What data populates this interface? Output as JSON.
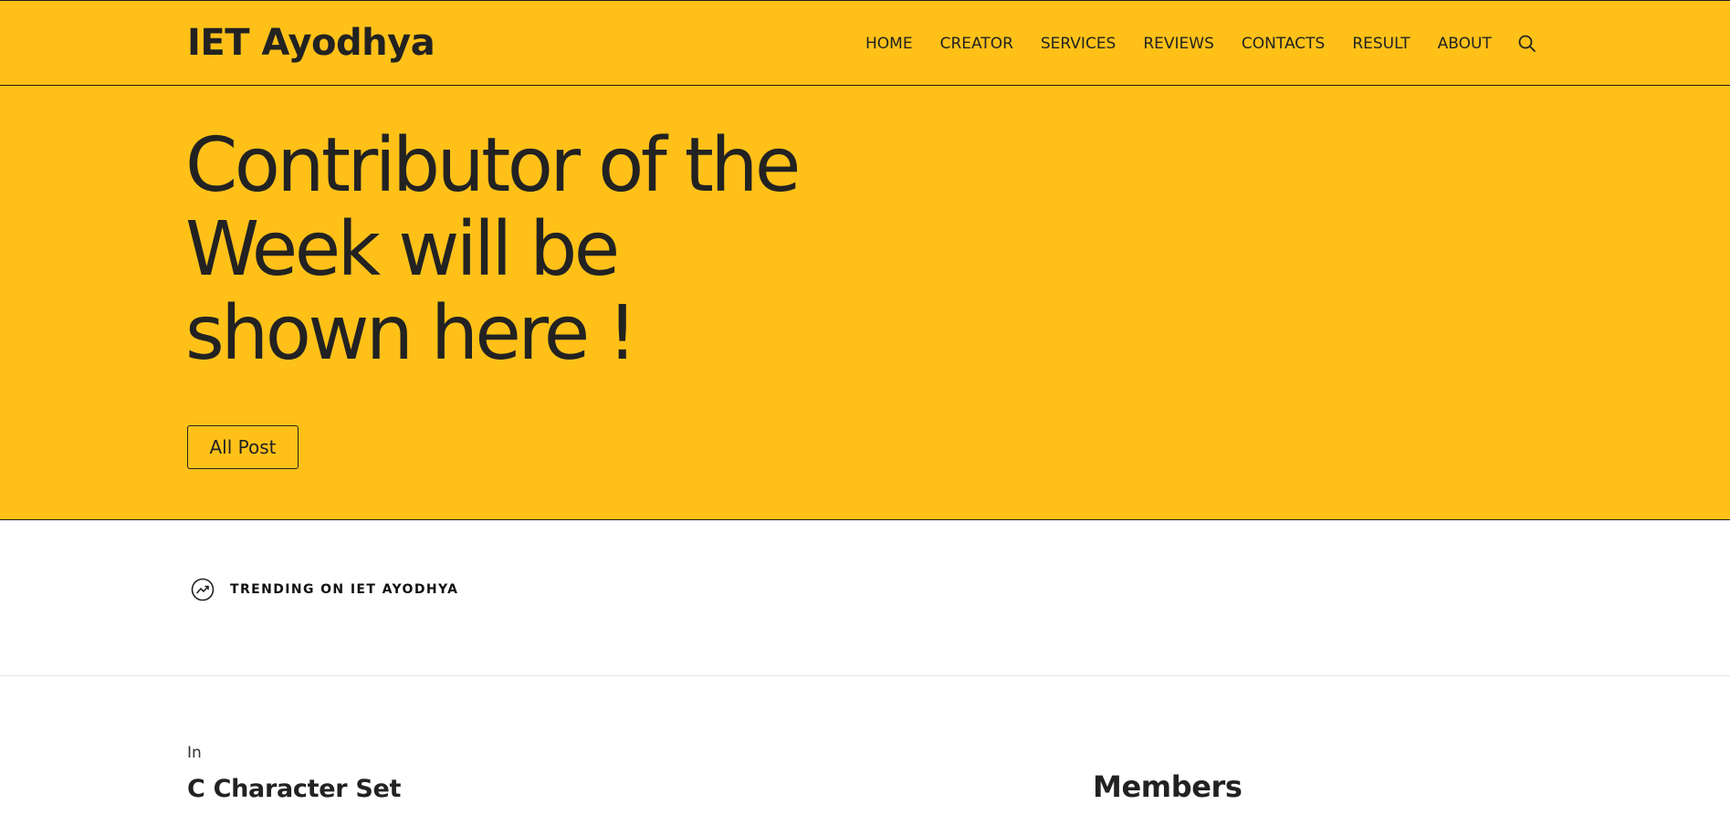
{
  "header": {
    "brand": "IET Ayodhya",
    "nav": [
      "HOME",
      "CREATOR",
      "SERVICES",
      "REVIEWS",
      "CONTACTS",
      "RESULT",
      "ABOUT"
    ],
    "search_icon": "search-icon"
  },
  "hero": {
    "title": "Contributor of the Week will be shown here !",
    "button_label": "All Post"
  },
  "trending": {
    "icon": "trending-up-icon",
    "label": "TRENDING ON IET AYODHYA"
  },
  "post": {
    "category_prefix": "In",
    "title": "C Character Set"
  },
  "sidebar": {
    "title": "Members"
  },
  "colors": {
    "accent": "#ffc118",
    "text": "#222222",
    "background": "#ffffff"
  }
}
